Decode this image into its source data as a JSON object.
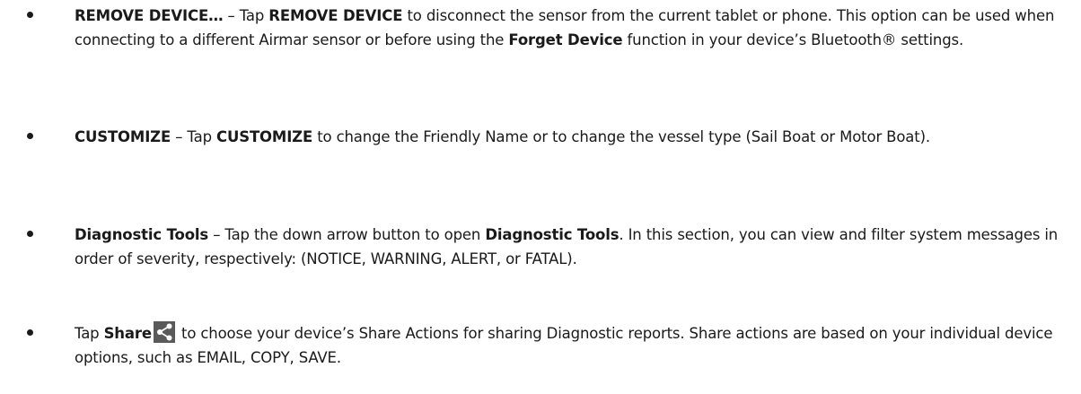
{
  "items": [
    {
      "term": "REMOVE DEVICE…",
      "sep": " – Tap ",
      "term2": "REMOVE DEVICE",
      "text_a": " to disconnect the sensor from the current tablet or phone. This option can be used when connecting to a different Airmar sensor or before using the ",
      "term3": "Forget Device",
      "text_b": " function in your device’s Bluetooth® settings."
    },
    {
      "term": "CUSTOMIZE",
      "sep": " – Tap ",
      "term2": "CUSTOMIZE",
      "text_a": " to change the Friendly Name or to change the vessel type (Sail Boat or Motor Boat)."
    },
    {
      "term": "Diagnostic Tools",
      "text_a": " – Tap the down arrow button to open ",
      "term2": "Diagnostic Tools",
      "text_b": ". In this section, you can view and filter system messages in order of severity, respectively: (NOTICE, WARNING, ALERT, or FATAL)."
    },
    {
      "lead": "Tap ",
      "term": "Share",
      "icon": "share-icon",
      "text_a": " to choose your device’s Share Actions for sharing Diagnostic reports. Share actions are based on your individual device options, such as EMAIL, COPY, SAVE."
    }
  ],
  "colors": {
    "text": "#1a1a1a",
    "icon_bg": "#5a5a5a",
    "icon_fg": "#ffffff"
  }
}
